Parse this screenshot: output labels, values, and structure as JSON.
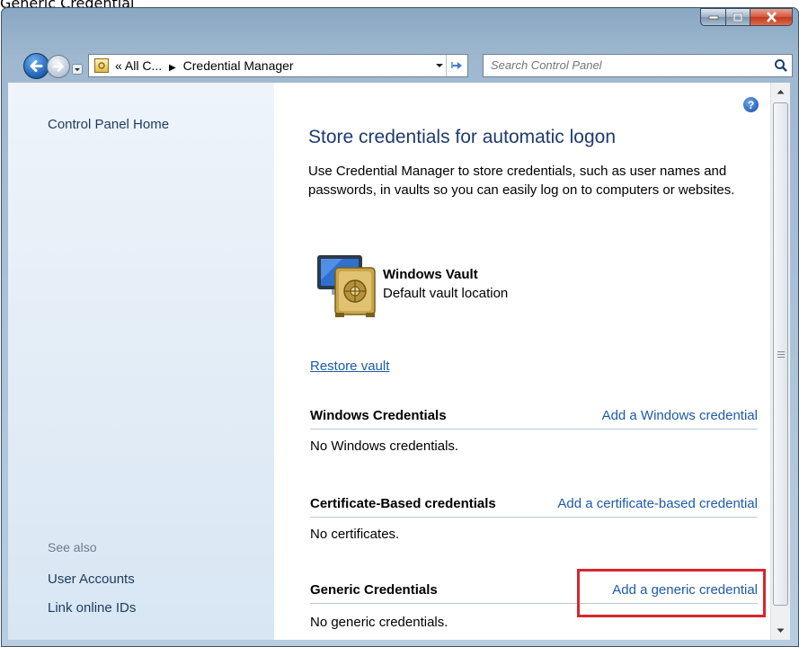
{
  "caption": "Generic Credential",
  "window_controls": {
    "minimize": "minimize-icon",
    "maximize": "maximize-icon",
    "close": "close-icon"
  },
  "address": {
    "chevrons": "«",
    "crumb_1": "All C...",
    "separator": "▶",
    "crumb_2": "Credential Manager"
  },
  "search": {
    "placeholder": "Search Control Panel"
  },
  "sidebar": {
    "home": "Control Panel Home",
    "see_also_label": "See also",
    "links": [
      "User Accounts",
      "Link online IDs"
    ]
  },
  "main": {
    "help": "?",
    "title": "Store credentials for automatic logon",
    "description": "Use Credential Manager to store credentials, such as user names and passwords, in vaults so you can easily log on to computers or websites.",
    "vault": {
      "name": "Windows Vault",
      "location": "Default vault location"
    },
    "restore_link": "Restore vault",
    "sections": [
      {
        "title": "Windows Credentials",
        "link": "Add a Windows credential",
        "empty": "No Windows credentials."
      },
      {
        "title": "Certificate-Based credentials",
        "link": "Add a certificate-based credential",
        "empty": "No certificates."
      },
      {
        "title": "Generic Credentials",
        "link": "Add a generic credential",
        "empty": "No generic credentials."
      }
    ]
  },
  "highlight_color": "#d6262e"
}
